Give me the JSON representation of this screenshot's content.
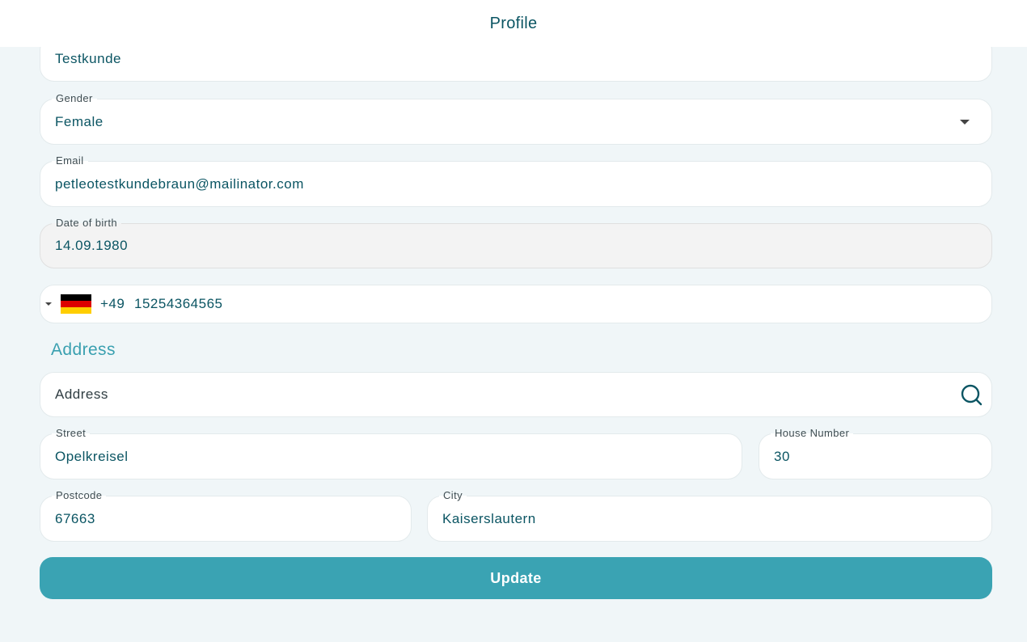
{
  "header": {
    "title": "Profile"
  },
  "form": {
    "name": {
      "value": "Testkunde"
    },
    "gender": {
      "label": "Gender",
      "value": "Female"
    },
    "email": {
      "label": "Email",
      "value": "petleotestkundebraun@mailinator.com"
    },
    "dob": {
      "label": "Date of birth",
      "value": "14.09.1980"
    },
    "phone": {
      "country_code": "+49",
      "number": "15254364565",
      "flag": "germany-flag"
    }
  },
  "address": {
    "section_title": "Address",
    "search": {
      "placeholder": "Address",
      "icon": "search-icon"
    },
    "street": {
      "label": "Street",
      "value": "Opelkreisel"
    },
    "house_number": {
      "label": "House Number",
      "value": "30"
    },
    "postcode": {
      "label": "Postcode",
      "value": "67663"
    },
    "city": {
      "label": "City",
      "value": "Kaiserslautern"
    }
  },
  "actions": {
    "update_label": "Update"
  },
  "colors": {
    "accent": "#3aa3b3",
    "text": "#0b5563",
    "background": "#f0f6f8"
  }
}
